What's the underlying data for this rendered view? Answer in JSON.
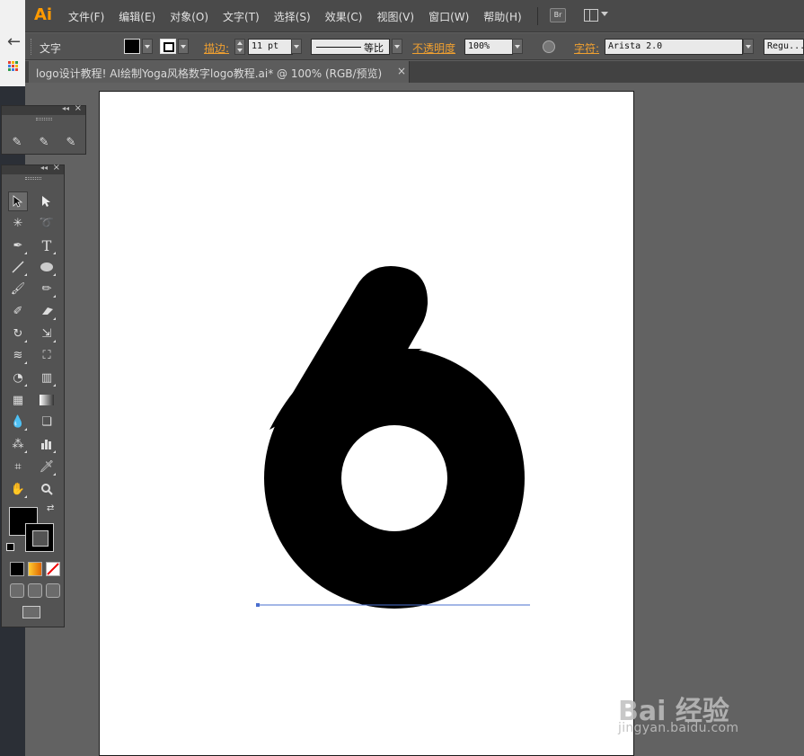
{
  "app": {
    "logo": "Ai",
    "menu": [
      "文件(F)",
      "编辑(E)",
      "对象(O)",
      "文字(T)",
      "选择(S)",
      "效果(C)",
      "视图(V)",
      "窗口(W)",
      "帮助(H)"
    ],
    "bridge_label": "Br"
  },
  "controlbar": {
    "tool_name": "文字",
    "stroke_label": "描边:",
    "stroke_weight": "11 pt",
    "stroke_profile": "等比",
    "opacity_label": "不透明度",
    "opacity_value": "100%",
    "char_label": "字符:",
    "font_family": "Arista 2.0",
    "font_style": "Regu..."
  },
  "document": {
    "tab_title": "logo设计教程! AI绘制Yoga风格数字logo教程.ai* @ 100% (RGB/预览)",
    "tab_close": "×"
  },
  "artwork": {
    "glyph": "6",
    "fill_color": "#000000",
    "guide_color": "#4a6fcf"
  },
  "toolbar_icons": [
    "selection-tool-icon",
    "direct-selection-tool-icon",
    "magic-wand-tool-icon",
    "lasso-tool-icon",
    "pen-tool-icon",
    "type-tool-icon",
    "line-tool-icon",
    "ellipse-tool-icon",
    "paintbrush-tool-icon",
    "pencil-tool-icon",
    "blob-brush-tool-icon",
    "eraser-tool-icon",
    "rotate-tool-icon",
    "scale-tool-icon",
    "warp-tool-icon",
    "free-transform-tool-icon",
    "shape-builder-tool-icon",
    "perspective-grid-tool-icon",
    "mesh-tool-icon",
    "gradient-tool-icon",
    "eyedropper-tool-icon",
    "blend-tool-icon",
    "symbol-sprayer-tool-icon",
    "column-graph-tool-icon",
    "artboard-tool-icon",
    "slice-tool-icon",
    "hand-tool-icon",
    "zoom-tool-icon"
  ],
  "watermark": {
    "brand": "Bai 经验",
    "site": "jingyan.baidu.com"
  }
}
